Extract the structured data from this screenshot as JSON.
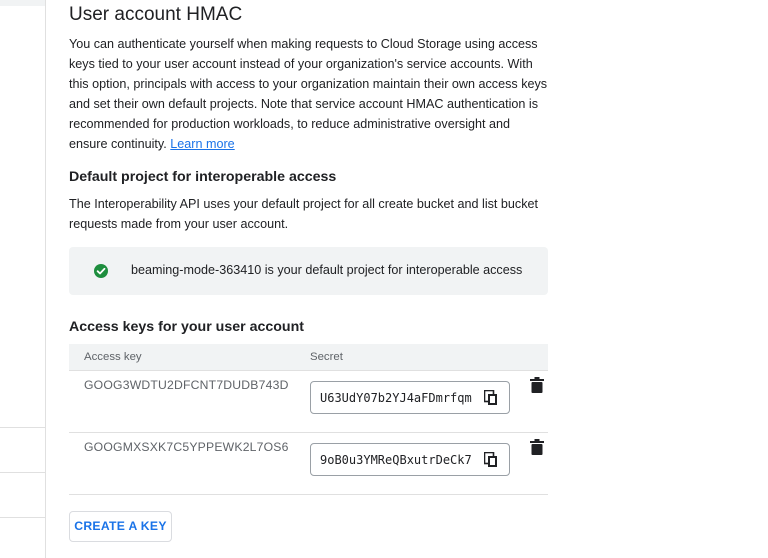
{
  "section": {
    "title": "User account HMAC",
    "description": "You can authenticate yourself when making requests to Cloud Storage using access keys tied to your user account instead of your organization's service accounts. With this option, principals with access to your organization maintain their own access keys and set their own default projects. Note that service account HMAC authentication is recommended for production workloads, to reduce administrative oversight and ensure continuity.",
    "learn_more": "Learn more"
  },
  "default_project": {
    "heading": "Default project for interoperable access",
    "description": "The Interoperability API uses your default project for all create bucket and list bucket requests made from your user account.",
    "notice": "beaming-mode-363410 is your default project for interoperable access",
    "notice_icon": "check-circle-icon",
    "notice_color": "#1e8e3e"
  },
  "access_keys": {
    "heading": "Access keys for your user account",
    "columns": [
      "Access key",
      "Secret"
    ],
    "rows": [
      {
        "access_key": "GOOG3WDTU2DFCNT7DUDB743D",
        "secret": "U63UdY07b2YJ4aFDmrfqm",
        "copy_icon": "copy-icon",
        "delete_icon": "trash-icon"
      },
      {
        "access_key": "GOOGMXSXK7C5YPPEWK2L7OS6",
        "secret": "9oB0u3YMReQBxutrDeCk7",
        "copy_icon": "copy-icon",
        "delete_icon": "trash-icon"
      }
    ],
    "create_button": "CREATE A KEY"
  },
  "colors": {
    "link": "#1a73e8",
    "text": "#202124",
    "muted": "#5f6368",
    "panel": "#f1f3f4"
  }
}
